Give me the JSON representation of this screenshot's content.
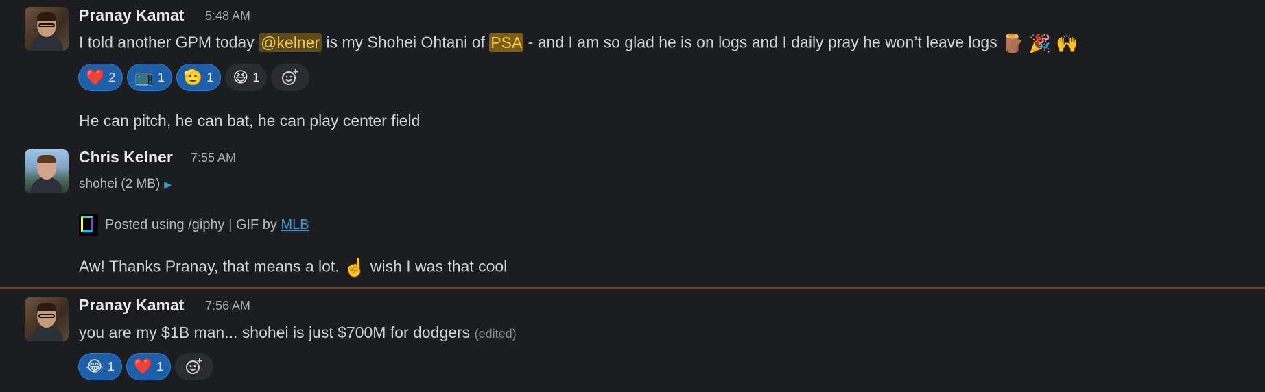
{
  "messages": [
    {
      "author": "Pranay Kamat",
      "time": "5:48 AM",
      "text_a": "I told another GPM today ",
      "mention": "@kelner",
      "text_b": " is my Shohei Ohtani of ",
      "highlight": "PSA",
      "text_c": " - and I am so glad he is on logs and I daily pray he won’t leave logs ",
      "trailing_emojis": "🪵 🎉 🙌",
      "reactions": [
        {
          "emoji": "❤️",
          "count": "2",
          "active": true
        },
        {
          "emoji": "📺",
          "count": "1",
          "active": true
        },
        {
          "emoji": "🫡",
          "count": "1",
          "active": true
        },
        {
          "emoji": "😆",
          "count": "1",
          "active": false
        }
      ],
      "followup": "He can pitch, he can bat, he can play center field"
    },
    {
      "author": "Chris Kelner",
      "time": "7:55 AM",
      "file_label": "shohei (2 MB)",
      "giphy_text": "Posted using /giphy | GIF by ",
      "giphy_link": "MLB",
      "text_a": "Aw! Thanks Pranay, that means a lot. ",
      "emoji": "☝️",
      "text_b": " wish I was that cool"
    },
    {
      "author": "Pranay Kamat",
      "time": "7:56 AM",
      "text": "you are my $1B man... shohei is just $700M for dodgers ",
      "edited": "(edited)",
      "reactions": [
        {
          "emoji": "😂",
          "count": "1",
          "active": true
        },
        {
          "emoji": "❤️",
          "count": "1",
          "active": true
        }
      ]
    }
  ],
  "colors": {
    "background": "#1b1d21",
    "reaction_active": "#1d5fa8",
    "mention_bg": "#5c4a1e",
    "mention_fg": "#f2c744",
    "link": "#3d9bd8",
    "new_divider": "#7a3a22"
  },
  "icons": {
    "add_reaction": "add-reaction-icon",
    "expand": "triangle-right-icon",
    "giphy": "giphy-logo-icon"
  }
}
